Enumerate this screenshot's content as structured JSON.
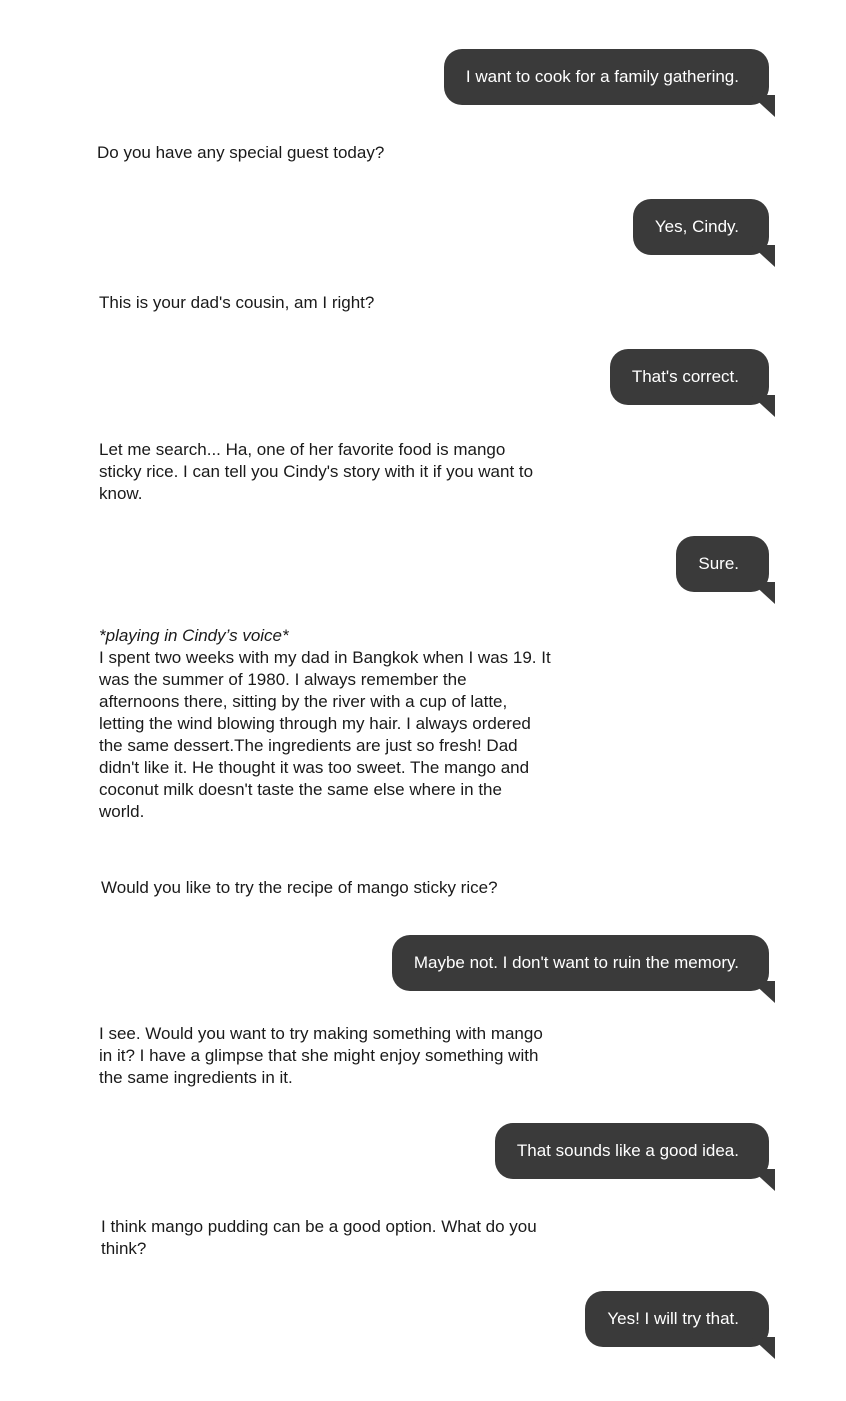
{
  "messages": {
    "u1": "I want to cook for a family gathering.",
    "b1": "Do you have any special guest today?",
    "u2": "Yes, Cindy.",
    "b2": "This is your dad's cousin, am I right?",
    "u3": "That's correct.",
    "b3": "Let me search... Ha, one of her favorite food is mango sticky rice. I can tell you Cindy's story with it if you want to know.",
    "u4": "Sure.",
    "b4_voice": "*playing in Cindy’s voice*",
    "b4": "I spent two weeks with my dad in Bangkok when I was 19. It was the summer of 1980. I always remember the afternoons there, sitting by the river with a cup of latte, letting the wind blowing through my hair. I always ordered the same dessert.The ingredients are just so fresh! Dad didn't like it. He thought it was too sweet. The mango and coconut milk doesn't taste the same else where in the world.",
    "b5": "Would you like to try the recipe of mango sticky rice?",
    "u5": "Maybe not. I don't want to ruin the memory.",
    "b6": "I see. Would you want to try making something with mango in it? I have a glimpse that she might enjoy something with the same ingredients in it.",
    "u6": "That sounds like a good idea.",
    "b7": "I think mango pudding can be a good option. What do you think?",
    "u7": "Yes! I will try that."
  },
  "colors": {
    "user_bubble": "#3a3a3a",
    "user_text": "#ffffff",
    "bot_text": "#1a1a1a",
    "background": "#ffffff"
  }
}
